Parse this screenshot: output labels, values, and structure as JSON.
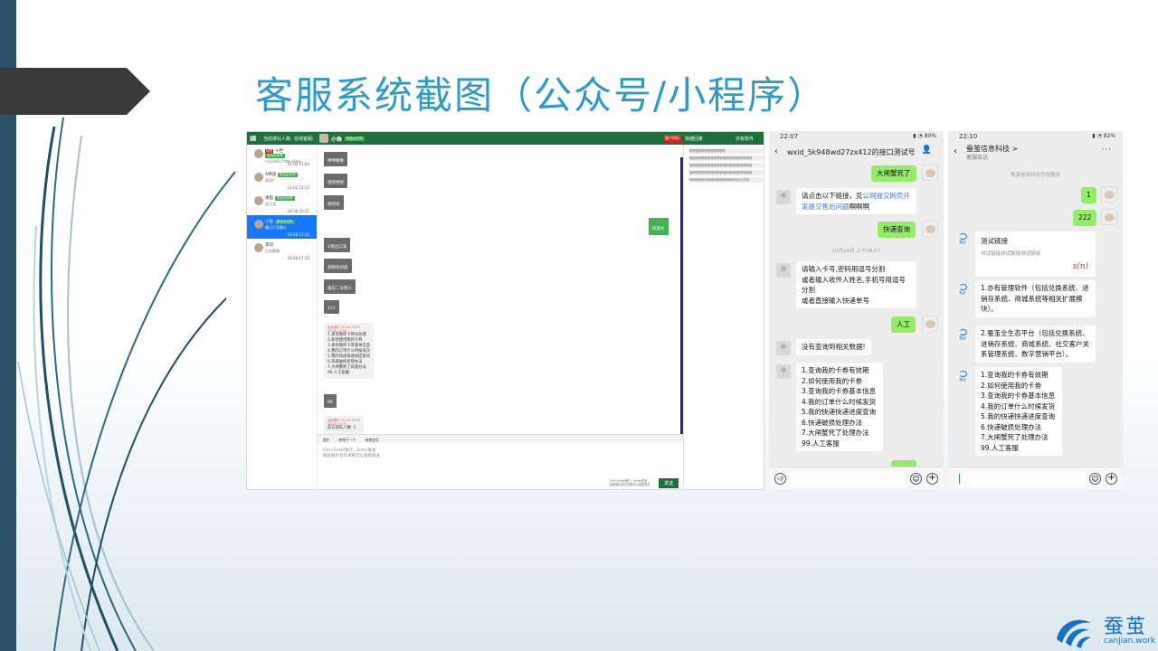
{
  "slide": {
    "title": "客服系统截图（公众号/小程序）"
  },
  "desktop": {
    "top_bar": {
      "tab_queue": "当前排队人数:",
      "tab_online": "在线客服:",
      "chat_name": "小鱼",
      "chat_tag": "来自公众号",
      "red_button": "客户资料",
      "quick_reply": "快捷回复",
      "software": "亦有软件"
    },
    "contacts": [
      {
        "name": "十世",
        "tag": "来自公众号",
        "preview": "<a href=\"http://ima...",
        "time": "11-02 13:42",
        "red": "标签"
      },
      {
        "name": "A晴道",
        "tag": "来自公众号",
        "preview": "再问?",
        "time": "11-02 13:17"
      },
      {
        "name": "清田",
        "tag": "来自公众号",
        "preview": "还万法",
        "time": "10-30 23:21"
      },
      {
        "name": "小鱼",
        "tag": "来自公众号",
        "preview": "喵日二号我人",
        "time": "10-20 17:11",
        "active": true
      },
      {
        "name": "李同",
        "preview": "后台版版",
        "time": "10-20 17:35"
      }
    ],
    "messages": [
      {
        "text": "咿咿喔喔"
      },
      {
        "text": "哈哈哈哈"
      },
      {
        "text": "哈哈哈"
      },
      {
        "text": "V现出口溪"
      },
      {
        "text": "基频效训遥"
      },
      {
        "text": "喵日二号我人"
      },
      {
        "text": "121"
      },
      {
        "text": "99"
      }
    ],
    "right_message": "阿遗大",
    "menu_card": {
      "head": "全民猜人 10-20 23:31",
      "head2": "10-20 23:31",
      "lines": [
        "1.查询我的卡券有效期",
        "2.如何使用我的卡券",
        "3.查询我的卡券基本信息",
        "4.我的订单什么时候发货",
        "5.我的快递快递进度查询",
        "6.快递破损处理办法",
        "7.大闸蟹死了处理办法",
        "99.人工客服"
      ]
    },
    "queue_card": {
      "head": "全民猜人 10-20 23:31",
      "head2": "10-20 23:31",
      "text": "前方排队人数: 1"
    },
    "tools": [
      "图片",
      "转给下一个",
      "结束会话"
    ],
    "input_hint": "Ctrl+Enter换行，Enter发送",
    "input_hint2": "粘贴图片到文本框可以直接发送",
    "send_hint": "Ctrl+Enter换行，Enter发送",
    "send_hint2": "粘贴图片到文本框可以直接发送",
    "send_button": "发送",
    "quick_rows": [
      "嗯嗯嗯嗯嗯嗯嗯嗯嗯嗯嗯嗯",
      "嘿嘿嘿嘿嘿嘿嘿嘿嘿嘿嘿嘿嘿嘿嘿嘿嘿嘿嘿嘿嘿",
      "嘿嘿嘿嘿嘿嘿嘿嘿嘿嘿嘿嘿嘿嘿嘿嘿嘿嘿嘿嘿嘿",
      "嘿嘿嘿嘿嘿嘿嘿嘿嘿嘿嘿嘿嘿嘿嘿嘿嘿嘿嘿嘿嘿",
      "呵呵呵呵呵呵呵呵呵呵呵呵呵呵呵呵大点作用"
    ]
  },
  "phone1": {
    "time": "22:07",
    "status": "80%",
    "title": "wxid_5k948wd27zx412的接口测试号",
    "msg1": "大闸蟹死了",
    "msg2_a": "请点击以下链接，见",
    "msg2_link": "公网提交网页开发提交售后问题",
    "msg2_b": "啊啊啊",
    "msg3": "快递查询",
    "timestamp": "10月20日 上午08:57",
    "msg4": "请输入卡号,密码用逗号分割\n或者输入收件人姓名,手机号用逗号分割\n或者直接输入快递单号",
    "msg5": "人工",
    "msg6": "没有查询到相关数据!",
    "msg7": "1.查询我的卡券有效期\n2.如何使用我的卡券\n3.查询我的卡券基本信息\n4.我的订单什么时候发货\n5.我的快递快递进度查询\n6.快递破损处理办法\n7.大闸蟹死了处理办法\n99.人工客服"
  },
  "phone2": {
    "time": "22:10",
    "status": "82%",
    "title": "蚕茧信息科技 >",
    "subtitle": "客服会话",
    "service_note": "蚕茧信息科技为您服务",
    "msg1": "1",
    "msg2": "222",
    "logo_label": "蚕茧",
    "card_title": "测试链接",
    "card_desc": "测试链接测试链接测试链接",
    "card_logo": "s(n)",
    "msg3": "1.亦有管理软件（包括兑换系统、进销存系统、商城系统等相关扩展模块）。",
    "msg4": "2.蚕茧全生态平台（包括兑换系统、进销存系统、商城系统、社交客户关系管理系统、数字营销平台）。",
    "msg5": "1.查询我的卡券有效期\n2.如何使用我的卡券\n3.查询我的卡券基本信息\n4.我的订单什么时候发货\n5.我的快递快递进度查询\n6.快递破损处理办法\n7.大闸蟹死了处理办法\n99.人工客服"
  },
  "brand": {
    "name": "蚕茧",
    "url": "canjian.work"
  },
  "colors": {
    "title": "#2e9bc7",
    "sidebar": "#2b5268",
    "desktop_green": "#1f6f3c",
    "wechat_green": "#95ec69",
    "brand": "#1b6fc4"
  }
}
